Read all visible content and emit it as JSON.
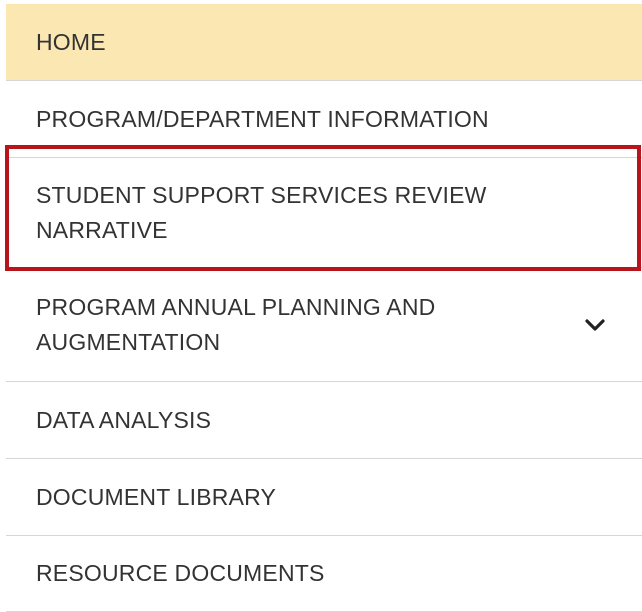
{
  "nav": {
    "items": [
      {
        "label": "HOME"
      },
      {
        "label": "PROGRAM/DEPARTMENT INFORMATION"
      },
      {
        "label": "STUDENT SUPPORT SERVICES REVIEW NARRATIVE"
      },
      {
        "label": "PROGRAM ANNUAL PLANNING AND AUGMENTATION"
      },
      {
        "label": "DATA ANALYSIS"
      },
      {
        "label": "DOCUMENT LIBRARY"
      },
      {
        "label": "RESOURCE DOCUMENTS"
      }
    ],
    "active_item": "HOME",
    "highlighted_item": "STUDENT SUPPORT SERVICES REVIEW NARRATIVE",
    "expandable_icon": "chevron-down-icon"
  },
  "colors": {
    "active_background": "#fbe7b2",
    "highlight_border": "#b8141c",
    "divider": "#d6d6d6",
    "text": "#333333"
  }
}
